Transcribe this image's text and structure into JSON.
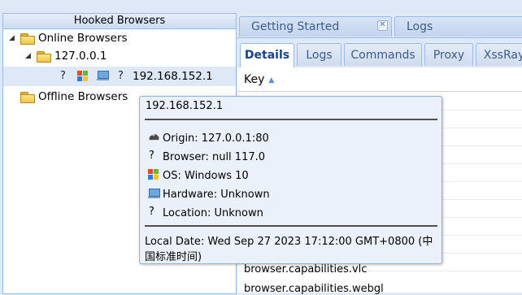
{
  "left_panel": {
    "title": "Hooked Browsers",
    "online_label": "Online Browsers",
    "host_label": "127.0.0.1",
    "browser_ip": "192.168.152.1",
    "offline_label": "Offline Browsers",
    "unknown_glyph": "?"
  },
  "main_tabs": [
    {
      "label": "Getting Started"
    },
    {
      "label": "Logs"
    }
  ],
  "sub_tabs": [
    {
      "label": "Details"
    },
    {
      "label": "Logs"
    },
    {
      "label": "Commands"
    },
    {
      "label": "Proxy"
    },
    {
      "label": "XssRay"
    }
  ],
  "grid": {
    "key_header": "Key",
    "rows": [
      "browser.capabilities.vlc",
      "browser.capabilities.webgl"
    ]
  },
  "tooltip": {
    "title": "192.168.152.1",
    "origin": "Origin: 127.0.0.1:80",
    "browser": "Browser: null 117.0",
    "os": "OS: Windows 10",
    "hardware": "Hardware: Unknown",
    "location": "Location: Unknown",
    "local_date": "Local Date: Wed Sep 27 2023 17:12:00 GMT+0800 (中国标准时间)"
  },
  "colors": {
    "panel_border": "#99bbe8",
    "active_tab_text": "#15428b",
    "tooltip_bg": "#eaf1fb"
  },
  "icons": [
    "folder-icon",
    "windows-icon",
    "hardware-icon",
    "unknown-icon",
    "cloud-icon",
    "close-icon",
    "sort-asc-icon"
  ]
}
